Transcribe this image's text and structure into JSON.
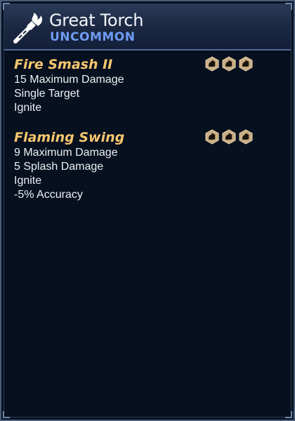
{
  "item": {
    "name": "Great Torch",
    "rarity": "UNCOMMON",
    "icon": "torch-icon"
  },
  "colors": {
    "rarity": "#6f9cf2",
    "skill_name": "#f6c76e",
    "background": "#07101f",
    "cost_token": "#c9ad84"
  },
  "skills": [
    {
      "name": "Fire Smash II",
      "cost_icon": "strength-token-icon",
      "cost_count": 3,
      "lines": [
        "15 Maximum Damage",
        "Single Target",
        "Ignite"
      ]
    },
    {
      "name": "Flaming Swing",
      "cost_icon": "strength-token-icon",
      "cost_count": 3,
      "lines": [
        "9 Maximum Damage",
        "5 Splash Damage",
        "Ignite",
        "-5% Accuracy"
      ]
    }
  ]
}
